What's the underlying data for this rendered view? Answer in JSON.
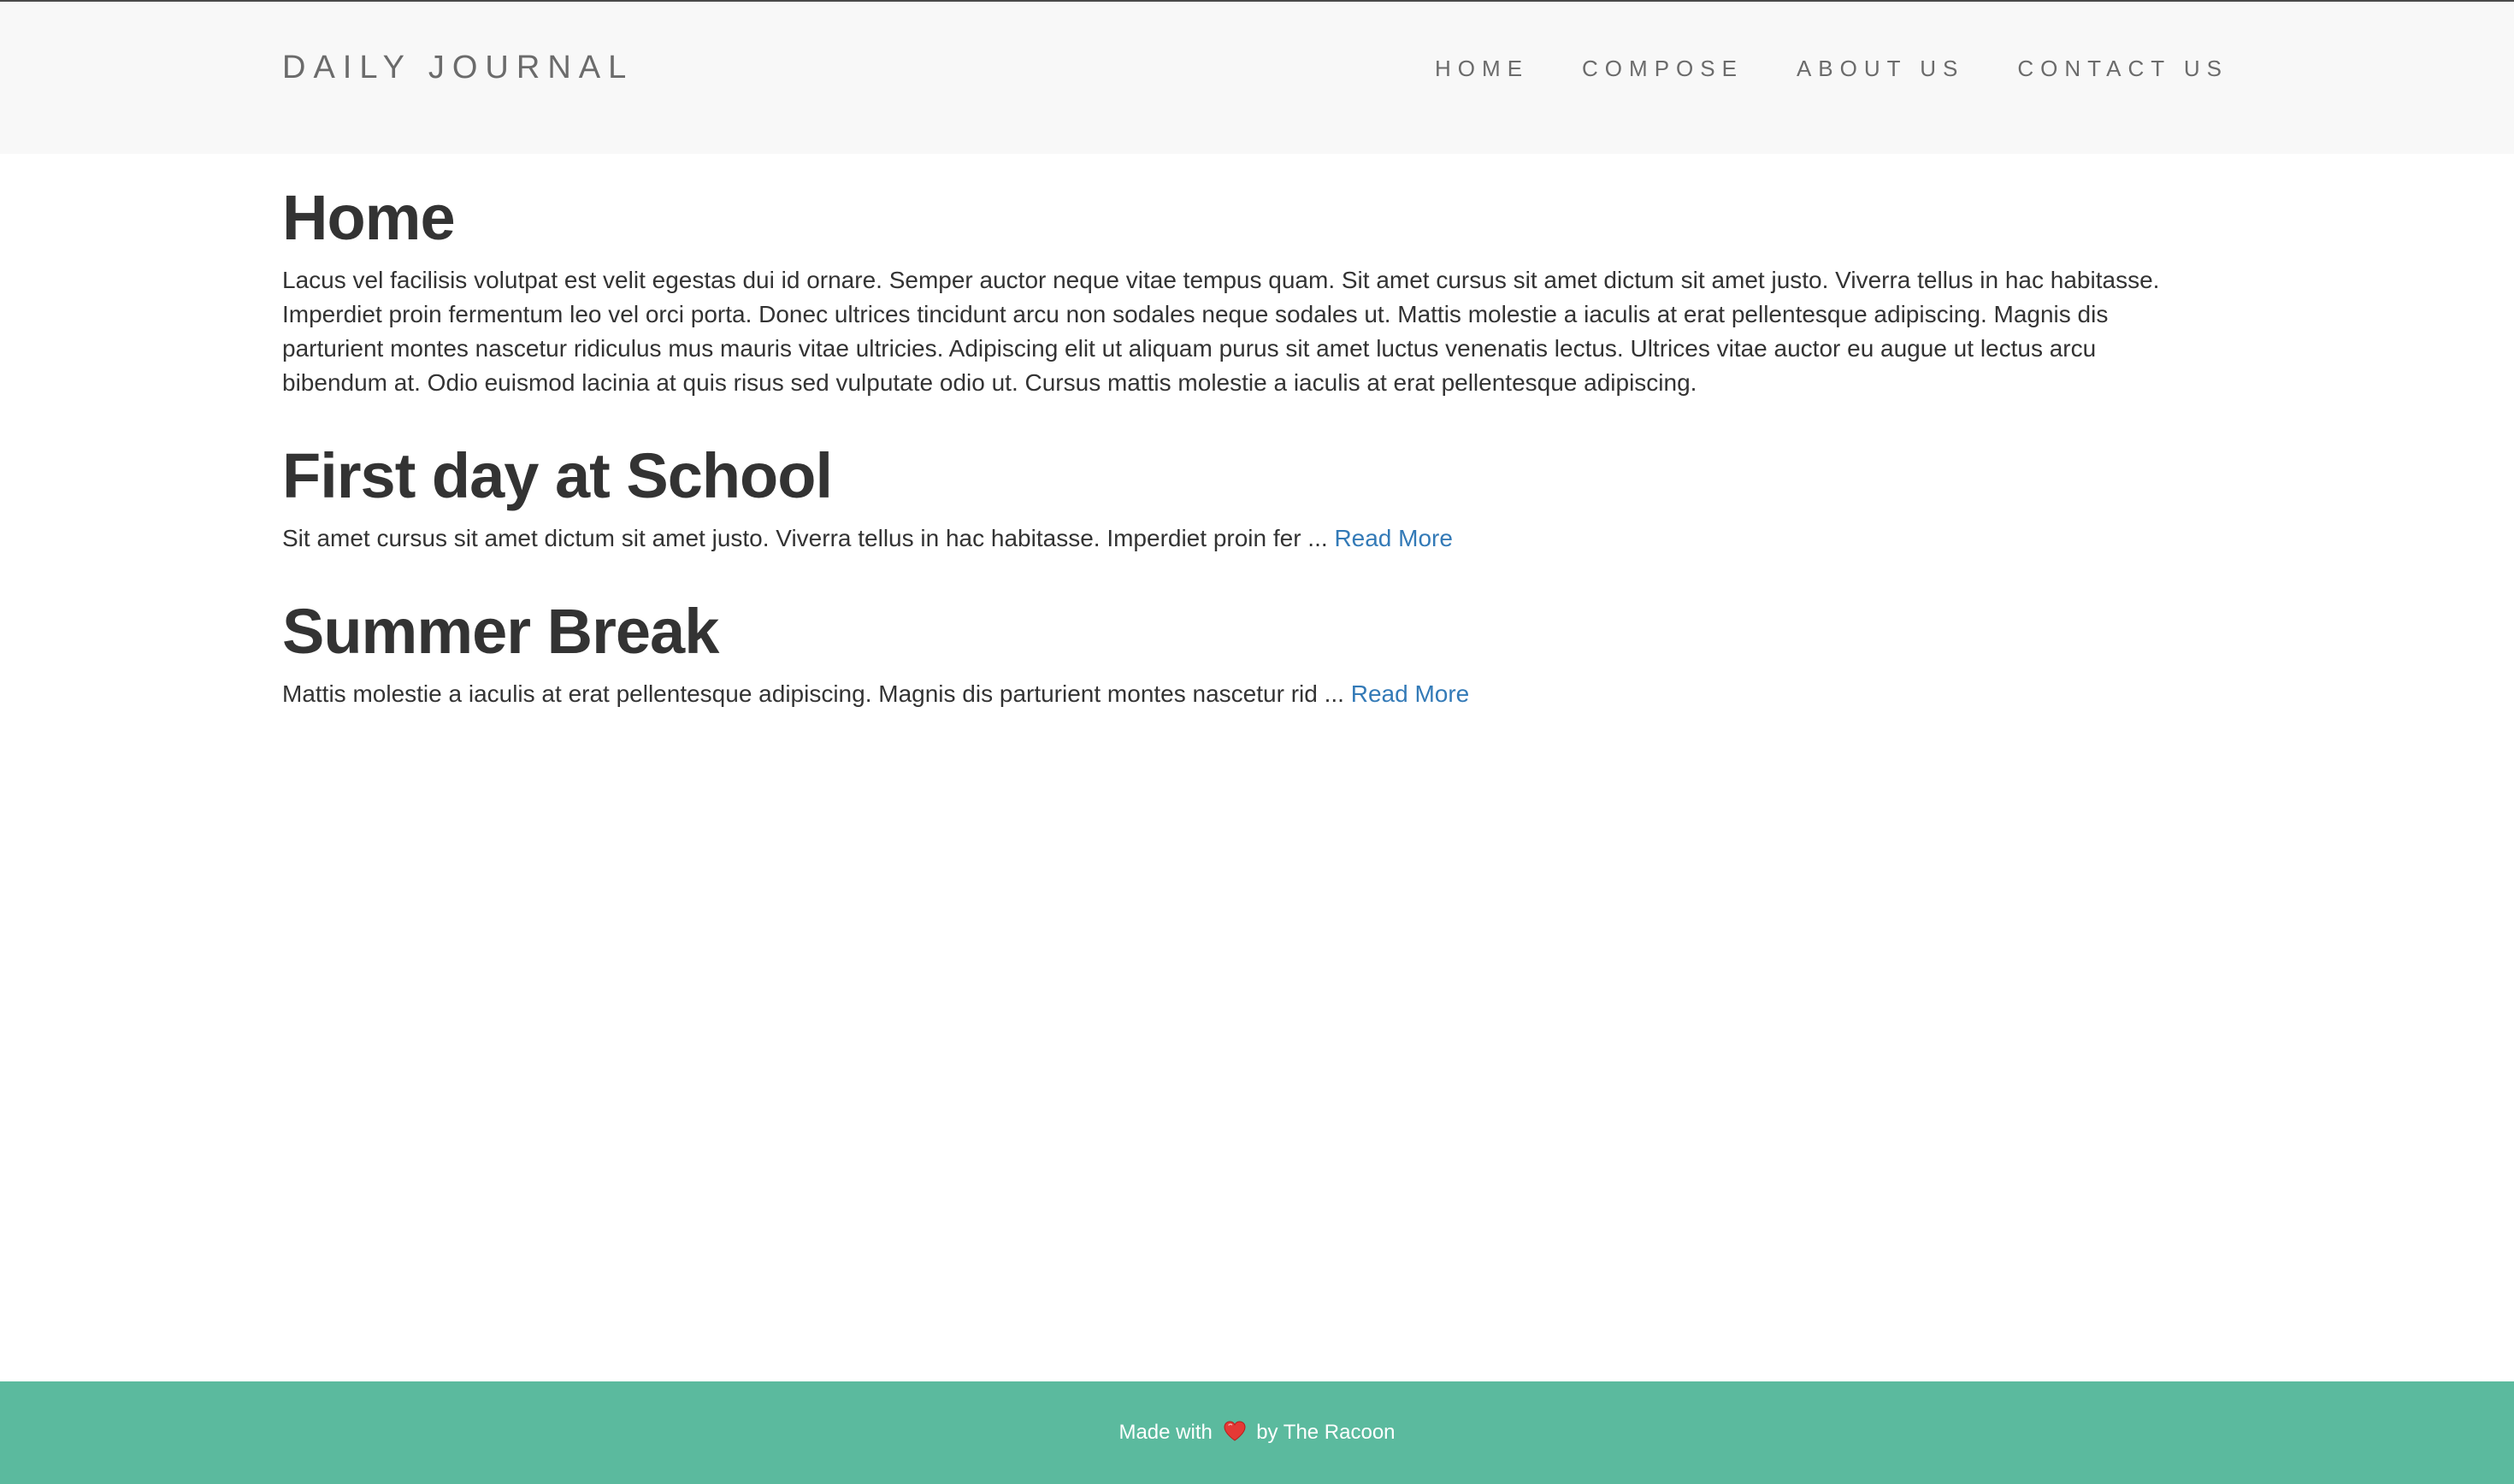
{
  "header": {
    "brand": "DAILY JOURNAL",
    "nav": [
      {
        "label": "HOME"
      },
      {
        "label": "COMPOSE"
      },
      {
        "label": "ABOUT US"
      },
      {
        "label": "CONTACT US"
      }
    ]
  },
  "main": {
    "title": "Home",
    "intro": "Lacus vel facilisis volutpat est velit egestas dui id ornare. Semper auctor neque vitae tempus quam. Sit amet cursus sit amet dictum sit amet justo. Viverra tellus in hac habitasse. Imperdiet proin fermentum leo vel orci porta. Donec ultrices tincidunt arcu non sodales neque sodales ut. Mattis molestie a iaculis at erat pellentesque adipiscing. Magnis dis parturient montes nascetur ridiculus mus mauris vitae ultricies. Adipiscing elit ut aliquam purus sit amet luctus venenatis lectus. Ultrices vitae auctor eu augue ut lectus arcu bibendum at. Odio euismod lacinia at quis risus sed vulputate odio ut. Cursus mattis molestie a iaculis at erat pellentesque adipiscing.",
    "posts": [
      {
        "title": "First day at School",
        "excerpt": "Sit amet cursus sit amet dictum sit amet justo. Viverra tellus in hac habitasse. Imperdiet proin fer ...",
        "read_more": "Read More"
      },
      {
        "title": "Summer Break",
        "excerpt": "Mattis molestie a iaculis at erat pellentesque adipiscing. Magnis dis parturient montes nascetur rid ...",
        "read_more": "Read More"
      }
    ]
  },
  "footer": {
    "made_with": "Made with",
    "heart_icon": "heart-icon",
    "by": "by The Racoon"
  },
  "colors": {
    "navbar_bg": "#f8f8f8",
    "footer_bg": "#5bba9e",
    "link": "#337ab7",
    "heart": "#e53935"
  }
}
